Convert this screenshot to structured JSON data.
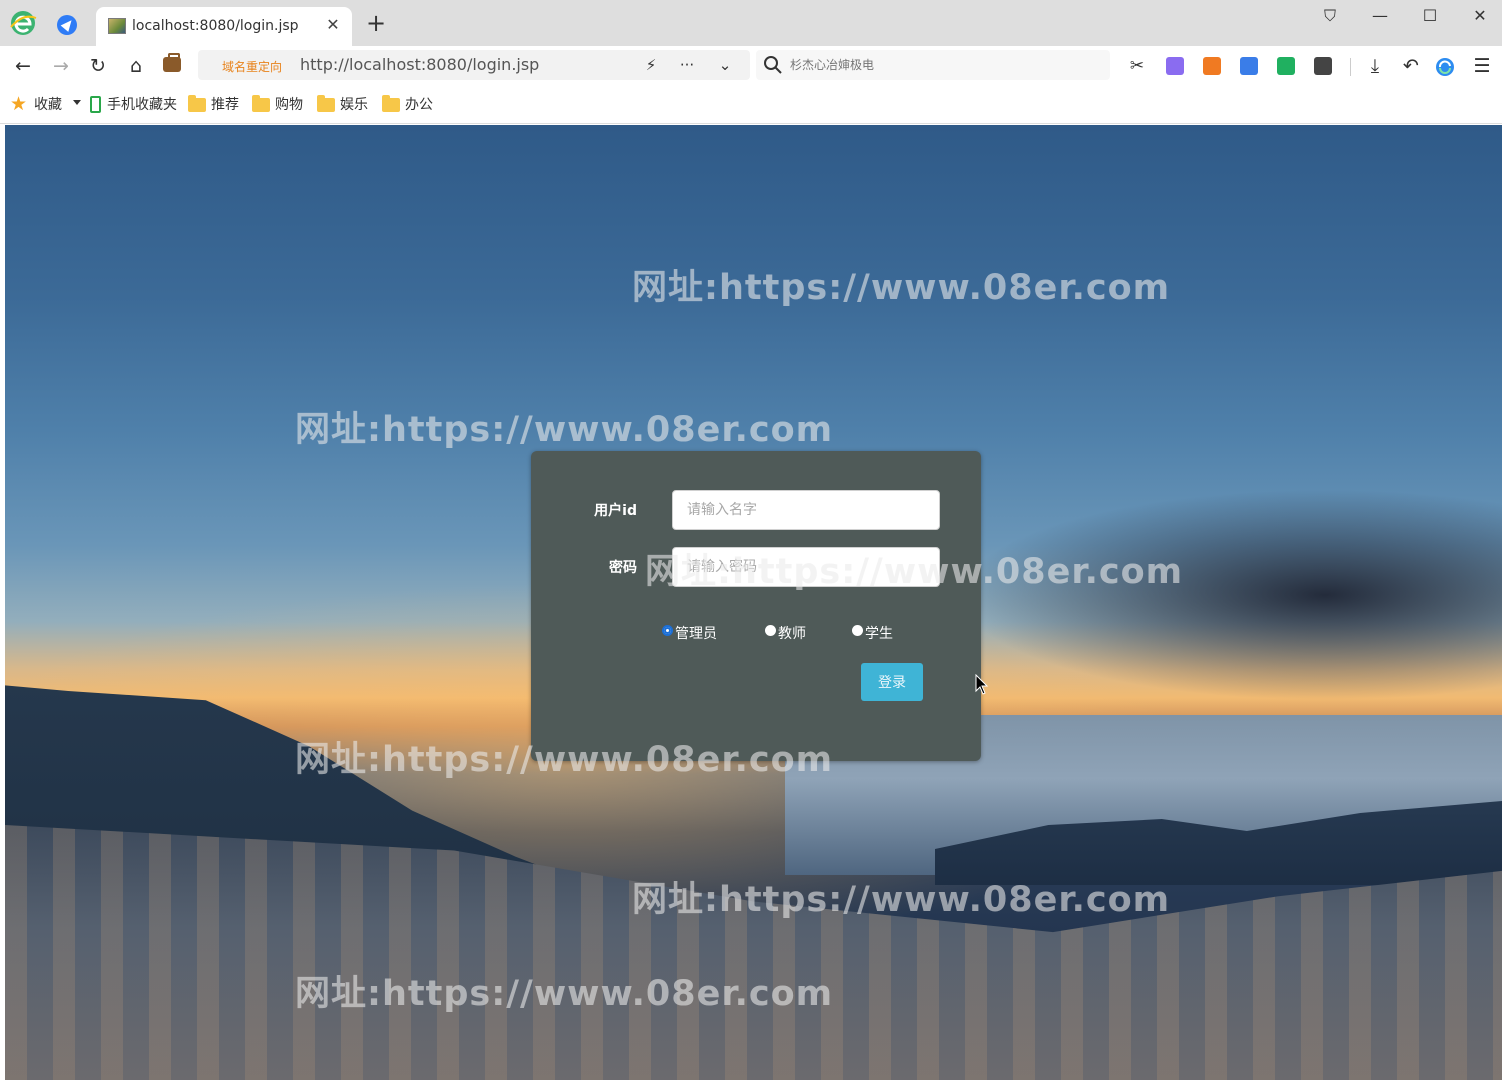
{
  "browser": {
    "tab": {
      "title": "localhost:8080/login.jsp"
    },
    "new_tab_label": "+",
    "window_controls": {
      "shirt": "⛉",
      "minimize": "—",
      "maximize": "☐",
      "close": "✕"
    },
    "nav": {
      "back": "←",
      "forward": "→",
      "reload": "↻",
      "home": "⌂"
    },
    "address": {
      "tag": "域名重定向",
      "url": "http://localhost:8080/login.jsp",
      "lightning": "⚡",
      "more": "···",
      "dropdown": "⌄"
    },
    "search": {
      "placeholder": "杉杰心冶婶极电"
    },
    "toolbar_icons": {
      "scissors": "✂",
      "download": "⤓",
      "undo": "↶",
      "menu": "☰"
    },
    "extension_colors": [
      "#8a6cf0",
      "#f07a22",
      "#3a7de8",
      "#20b060",
      "#444444"
    ],
    "bookmarks": [
      {
        "label": "收藏",
        "icon": "star-icon"
      },
      {
        "label": "手机收藏夹",
        "icon": "phone-icon"
      },
      {
        "label": "推荐",
        "icon": "folder-icon"
      },
      {
        "label": "购物",
        "icon": "folder-icon"
      },
      {
        "label": "娱乐",
        "icon": "folder-icon"
      },
      {
        "label": "办公",
        "icon": "folder-icon"
      }
    ]
  },
  "watermark": "网址:https://www.08er.com",
  "login": {
    "user_label": "用户id",
    "user_placeholder": "请输入名字",
    "password_label": "密码",
    "password_placeholder": "请输入密码",
    "roles": [
      {
        "label": "管理员",
        "checked": true
      },
      {
        "label": "教师",
        "checked": false
      },
      {
        "label": "学生",
        "checked": false
      }
    ],
    "submit_label": "登录"
  },
  "colors": {
    "panel": "#4f5a58",
    "button": "#3fb4d6",
    "radio_checked": "#1c6fd6"
  }
}
